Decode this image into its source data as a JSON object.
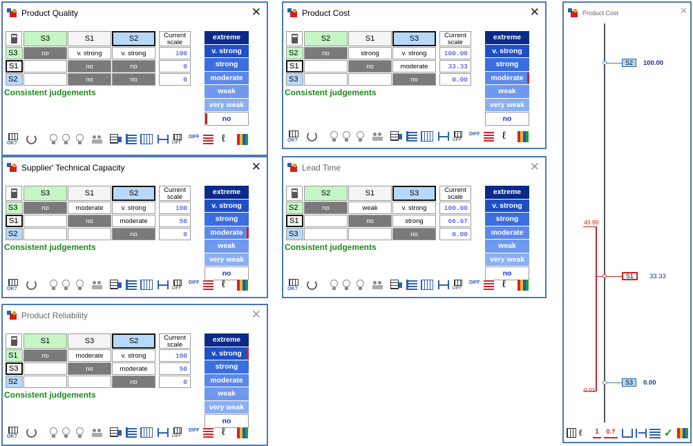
{
  "colors": {
    "frame": "#4a78b8",
    "green": "#c6f5c6",
    "blue": "#b8d8f8",
    "dark": "#7a7a7a",
    "consistent": "#1a8a1a",
    "sel": "#d42020",
    "scale": "#1f2fd2"
  },
  "verbal_scale": [
    "extreme",
    "v. strong",
    "strong",
    "moderate",
    "weak",
    "very weak",
    "no"
  ],
  "scale_header": "Current scale",
  "windows": [
    {
      "title": "Product Quality",
      "columns": [
        "S3",
        "S1",
        "S2"
      ],
      "rows": [
        {
          "label": "S3",
          "cells": [
            "no",
            "v. strong",
            "v. strong"
          ],
          "scale": "100"
        },
        {
          "label": "S1",
          "cells": [
            "",
            "no",
            "no"
          ],
          "scale": "0"
        },
        {
          "label": "S2",
          "cells": [
            "",
            "no",
            "no"
          ],
          "scale": "0"
        }
      ],
      "status": "Consistent judgements",
      "selected_verbal": "no"
    },
    {
      "title": "Product Cost",
      "columns": [
        "S2",
        "S1",
        "S3"
      ],
      "rows": [
        {
          "label": "S2",
          "cells": [
            "no",
            "strong",
            "v. strong"
          ],
          "scale": "100.00"
        },
        {
          "label": "S1",
          "cells": [
            "",
            "no",
            "moderate"
          ],
          "scale": "33.33"
        },
        {
          "label": "S3",
          "cells": [
            "",
            "",
            "no"
          ],
          "scale": "0.00"
        }
      ],
      "status": "Consistent judgements",
      "selected_verbal": "moderate"
    },
    {
      "title": "Supplier' Technical Capacity",
      "columns": [
        "S3",
        "S1",
        "S2"
      ],
      "rows": [
        {
          "label": "S3",
          "cells": [
            "no",
            "moderate",
            "v. strong"
          ],
          "scale": "100"
        },
        {
          "label": "S1",
          "cells": [
            "",
            "no",
            "moderate"
          ],
          "scale": "50"
        },
        {
          "label": "S2",
          "cells": [
            "",
            "",
            "no"
          ],
          "scale": "0"
        }
      ],
      "status": "Consistent judgements",
      "selected_verbal": "moderate"
    },
    {
      "title": "Lead Time",
      "columns": [
        "S2",
        "S1",
        "S3"
      ],
      "rows": [
        {
          "label": "S2",
          "cells": [
            "no",
            "weak",
            "v. strong"
          ],
          "scale": "100.00"
        },
        {
          "label": "S1",
          "cells": [
            "",
            "no",
            "strong"
          ],
          "scale": "66.67"
        },
        {
          "label": "S3",
          "cells": [
            "",
            "",
            "no"
          ],
          "scale": "0.00"
        }
      ],
      "status": "Consistent judgements",
      "selected_verbal": ""
    },
    {
      "title": "Product Reliability",
      "columns": [
        "S1",
        "S3",
        "S2"
      ],
      "rows": [
        {
          "label": "S1",
          "cells": [
            "no",
            "moderate",
            "v. strong"
          ],
          "scale": "100"
        },
        {
          "label": "S3",
          "cells": [
            "",
            "no",
            "moderate"
          ],
          "scale": "50"
        },
        {
          "label": "S2",
          "cells": [
            "",
            "",
            "no"
          ],
          "scale": "0"
        }
      ],
      "status": "Consistent judgements",
      "selected_verbal": "v. strong"
    }
  ],
  "toolbar_labels": {
    "ok": "OK?",
    "diff": "DIFF",
    "ok_small": "ok"
  },
  "sensitivity": {
    "title": "Product Cost",
    "items": [
      {
        "label": "S2",
        "value": "100.00"
      },
      {
        "label": "S1",
        "value": "33.33"
      },
      {
        "label": "S3",
        "value": "0.00"
      }
    ],
    "range_top": "49.99",
    "range_bottom": "0.01",
    "toolbar_labels": [
      "1",
      "0.?"
    ]
  }
}
